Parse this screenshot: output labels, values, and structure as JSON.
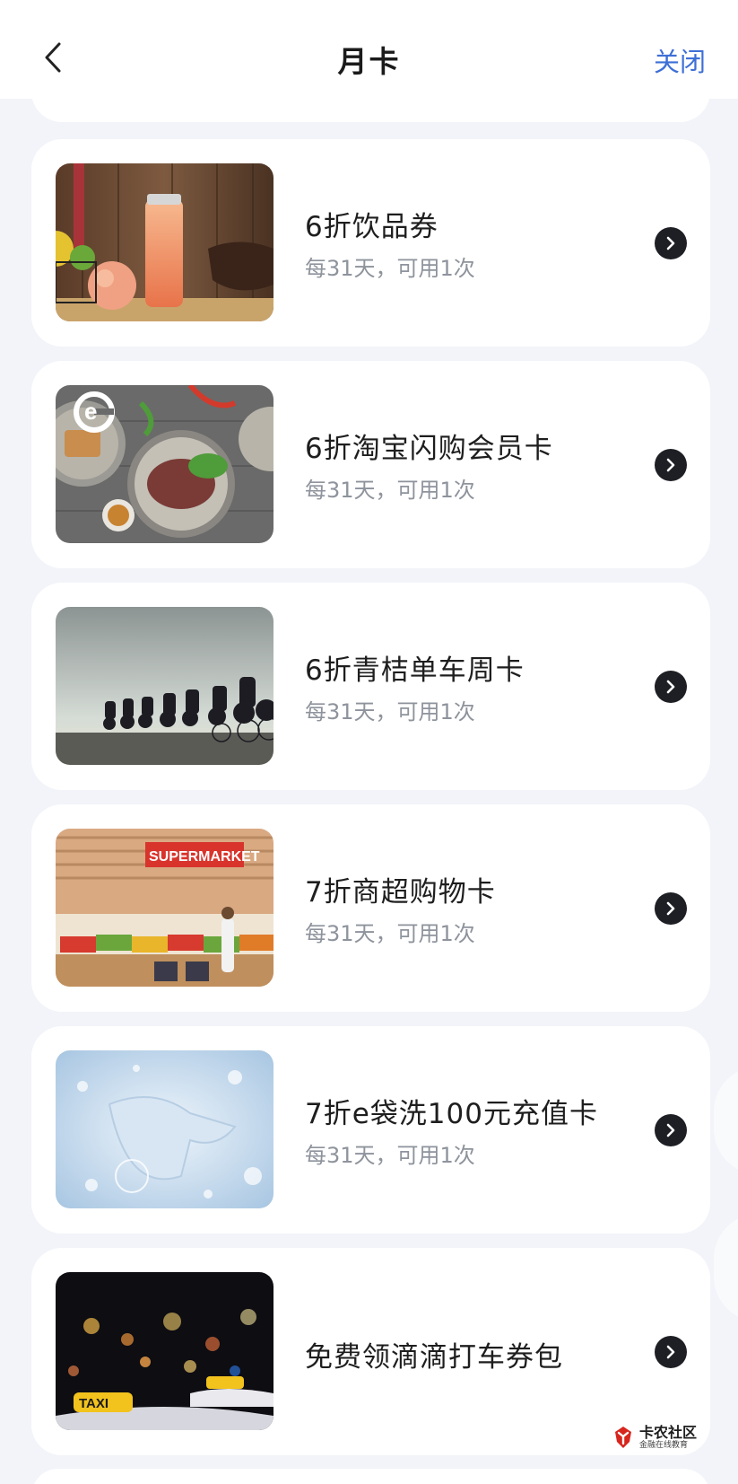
{
  "nav": {
    "title": "月卡",
    "close_label": "关闭"
  },
  "cards": [
    {
      "title": "6折饮品券",
      "subtitle": "每31天，可用1次",
      "image": "drink-photo"
    },
    {
      "title": "6折淘宝闪购会员卡",
      "subtitle": "每31天，可用1次",
      "image": "food-plates-photo",
      "badge_letter": "e"
    },
    {
      "title": "6折青桔单车周卡",
      "subtitle": "每31天，可用1次",
      "image": "cyclists-photo"
    },
    {
      "title": "7折商超购物卡",
      "subtitle": "每31天，可用1次",
      "image": "supermarket-photo",
      "sign_text": "SUPERMARKET"
    },
    {
      "title": "7折e袋洗100元充值卡",
      "subtitle": "每31天，可用1次",
      "image": "laundry-water-photo"
    },
    {
      "title": "免费领滴滴打车券包",
      "subtitle": "",
      "image": "taxi-night-photo",
      "sign_text": "TAXI"
    }
  ],
  "watermark": {
    "main": "卡农社区",
    "small": "金融在线教育"
  },
  "colors": {
    "accent_link": "#3d6fd6",
    "page_background": "#f2f4f9",
    "arrow_button": "#1d1f24"
  }
}
